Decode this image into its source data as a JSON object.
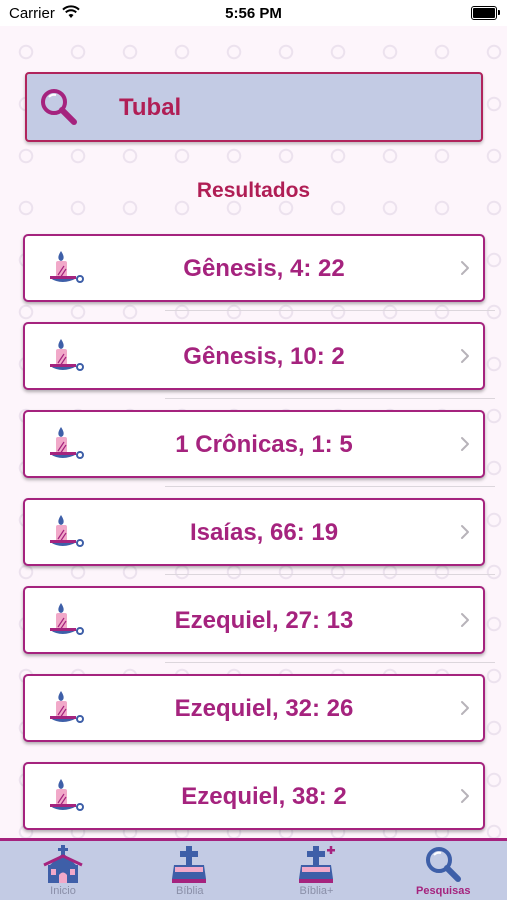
{
  "status_bar": {
    "carrier": "Carrier",
    "time": "5:56 PM"
  },
  "search": {
    "term": "Tubal"
  },
  "results": {
    "title": "Resultados",
    "items": [
      {
        "ref": "Gênesis, 4: 22"
      },
      {
        "ref": "Gênesis, 10: 2"
      },
      {
        "ref": "1 Crônicas, 1: 5"
      },
      {
        "ref": "Isaías, 66: 19"
      },
      {
        "ref": "Ezequiel, 27: 13"
      },
      {
        "ref": "Ezequiel, 32: 26"
      },
      {
        "ref": "Ezequiel, 38: 2"
      }
    ]
  },
  "tabs": [
    {
      "label": "Inicio",
      "icon": "church-icon",
      "active": false
    },
    {
      "label": "Bíblia",
      "icon": "bible-icon",
      "active": false
    },
    {
      "label": "Bíblia+",
      "icon": "bible-plus-icon",
      "active": false
    },
    {
      "label": "Pesquisas",
      "icon": "search-icon",
      "active": true
    }
  ],
  "colors": {
    "accent": "#a5237e",
    "title": "#b01e55",
    "bar": "#c3cbe4",
    "icon_blue": "#3e5fa8"
  }
}
